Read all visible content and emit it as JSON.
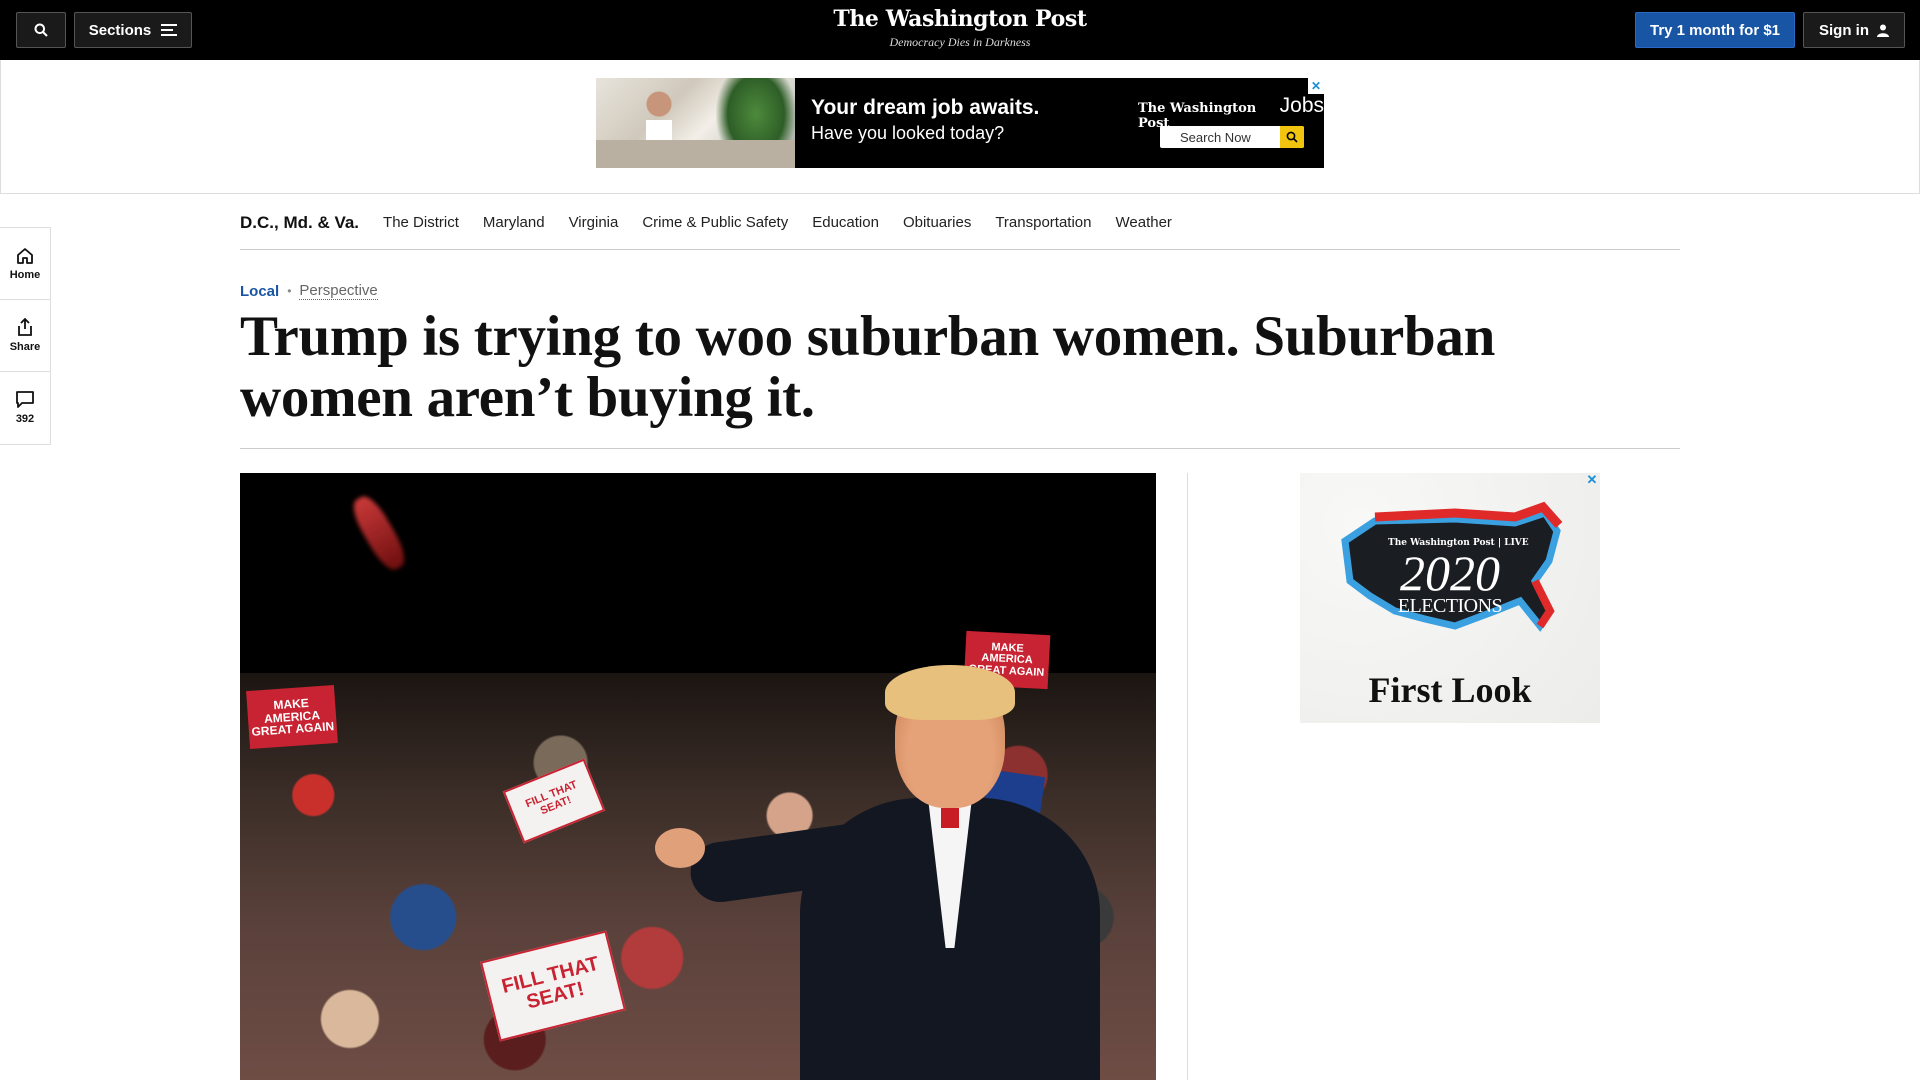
{
  "header": {
    "sections_label": "Sections",
    "logo": "The Washington Post",
    "tagline": "Democracy Dies in Darkness",
    "trial_label": "Try 1 month for $1",
    "signin_label": "Sign in"
  },
  "banner_ad": {
    "headline": "Your dream job awaits.",
    "subline": "Have you looked today?",
    "brand": "The Washington Post",
    "brand_suffix": "Jobs",
    "search_label": "Search Now",
    "close_label": "✕"
  },
  "rail": {
    "home": "Home",
    "share": "Share",
    "comments_count": "392"
  },
  "section_nav": {
    "title": "D.C., Md. & Va.",
    "links": [
      "The District",
      "Maryland",
      "Virginia",
      "Crime & Public Safety",
      "Education",
      "Obituaries",
      "Transportation",
      "Weather"
    ]
  },
  "article": {
    "section": "Local",
    "dot": "•",
    "label": "Perspective",
    "headline": "Trump is trying to woo suburban women. Suburban women aren’t buying it."
  },
  "photo_signs": {
    "maga": "MAKE AMERICA GREAT AGAIN",
    "fill_seat": "FILL THAT SEAT!",
    "maga_short": "MAKE AMERICA GREAT AGAIN"
  },
  "side_ad": {
    "brand": "The Washington Post | LIVE",
    "year": "2020",
    "word": "ELECTIONS",
    "tagline": "First Look",
    "close_label": "✕"
  },
  "colors": {
    "topbar": "#000000",
    "accent_blue": "#1955a5",
    "map_red": "#e02a2a",
    "map_blue": "#3aa0e0"
  }
}
